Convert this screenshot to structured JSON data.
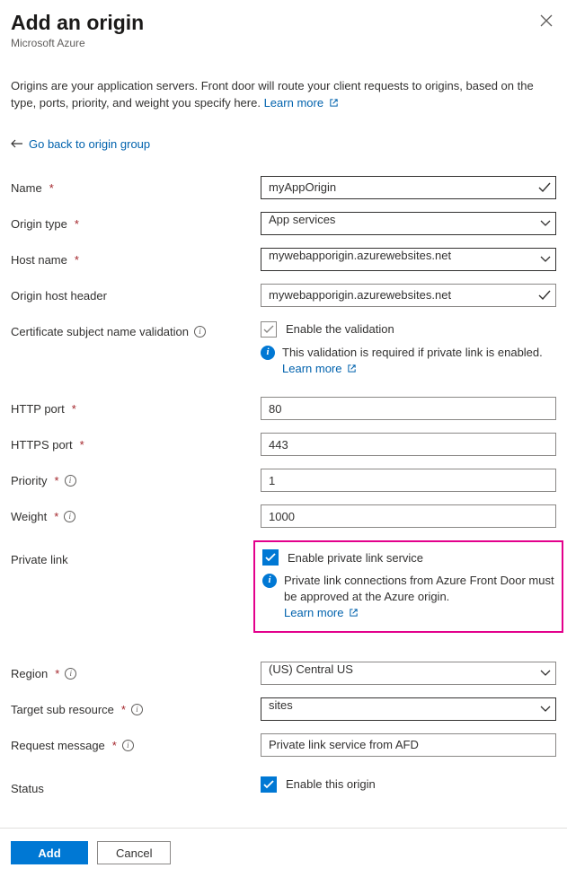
{
  "header": {
    "title": "Add an origin",
    "subtitle": "Microsoft Azure"
  },
  "description": {
    "text": "Origins are your application servers. Front door will route your client requests to origins, based on the type, ports, priority, and weight you specify here. ",
    "learn_more": "Learn more"
  },
  "back_link": "Go back to origin group",
  "fields": {
    "name": {
      "label": "Name",
      "value": "myAppOrigin"
    },
    "origin_type": {
      "label": "Origin type",
      "value": "App services"
    },
    "host_name": {
      "label": "Host name",
      "value": "mywebapporigin.azurewebsites.net"
    },
    "origin_host_header": {
      "label": "Origin host header",
      "value": "mywebapporigin.azurewebsites.net"
    },
    "cert_validation": {
      "label": "Certificate subject name validation",
      "checkbox_label": "Enable the validation",
      "info_text": "This validation is required if private link is enabled. ",
      "learn_more": "Learn more"
    },
    "http_port": {
      "label": "HTTP port",
      "value": "80"
    },
    "https_port": {
      "label": "HTTPS port",
      "value": "443"
    },
    "priority": {
      "label": "Priority",
      "value": "1"
    },
    "weight": {
      "label": "Weight",
      "value": "1000"
    },
    "private_link": {
      "label": "Private link",
      "checkbox_label": "Enable private link service",
      "info_text": "Private link connections from Azure Front Door must be approved at the Azure origin.",
      "learn_more": "Learn more"
    },
    "region": {
      "label": "Region",
      "value": "(US) Central US"
    },
    "target_sub_resource": {
      "label": "Target sub resource",
      "value": "sites"
    },
    "request_message": {
      "label": "Request message",
      "value": "Private link service from AFD"
    },
    "status": {
      "label": "Status",
      "checkbox_label": "Enable this origin"
    }
  },
  "footer": {
    "add": "Add",
    "cancel": "Cancel"
  }
}
